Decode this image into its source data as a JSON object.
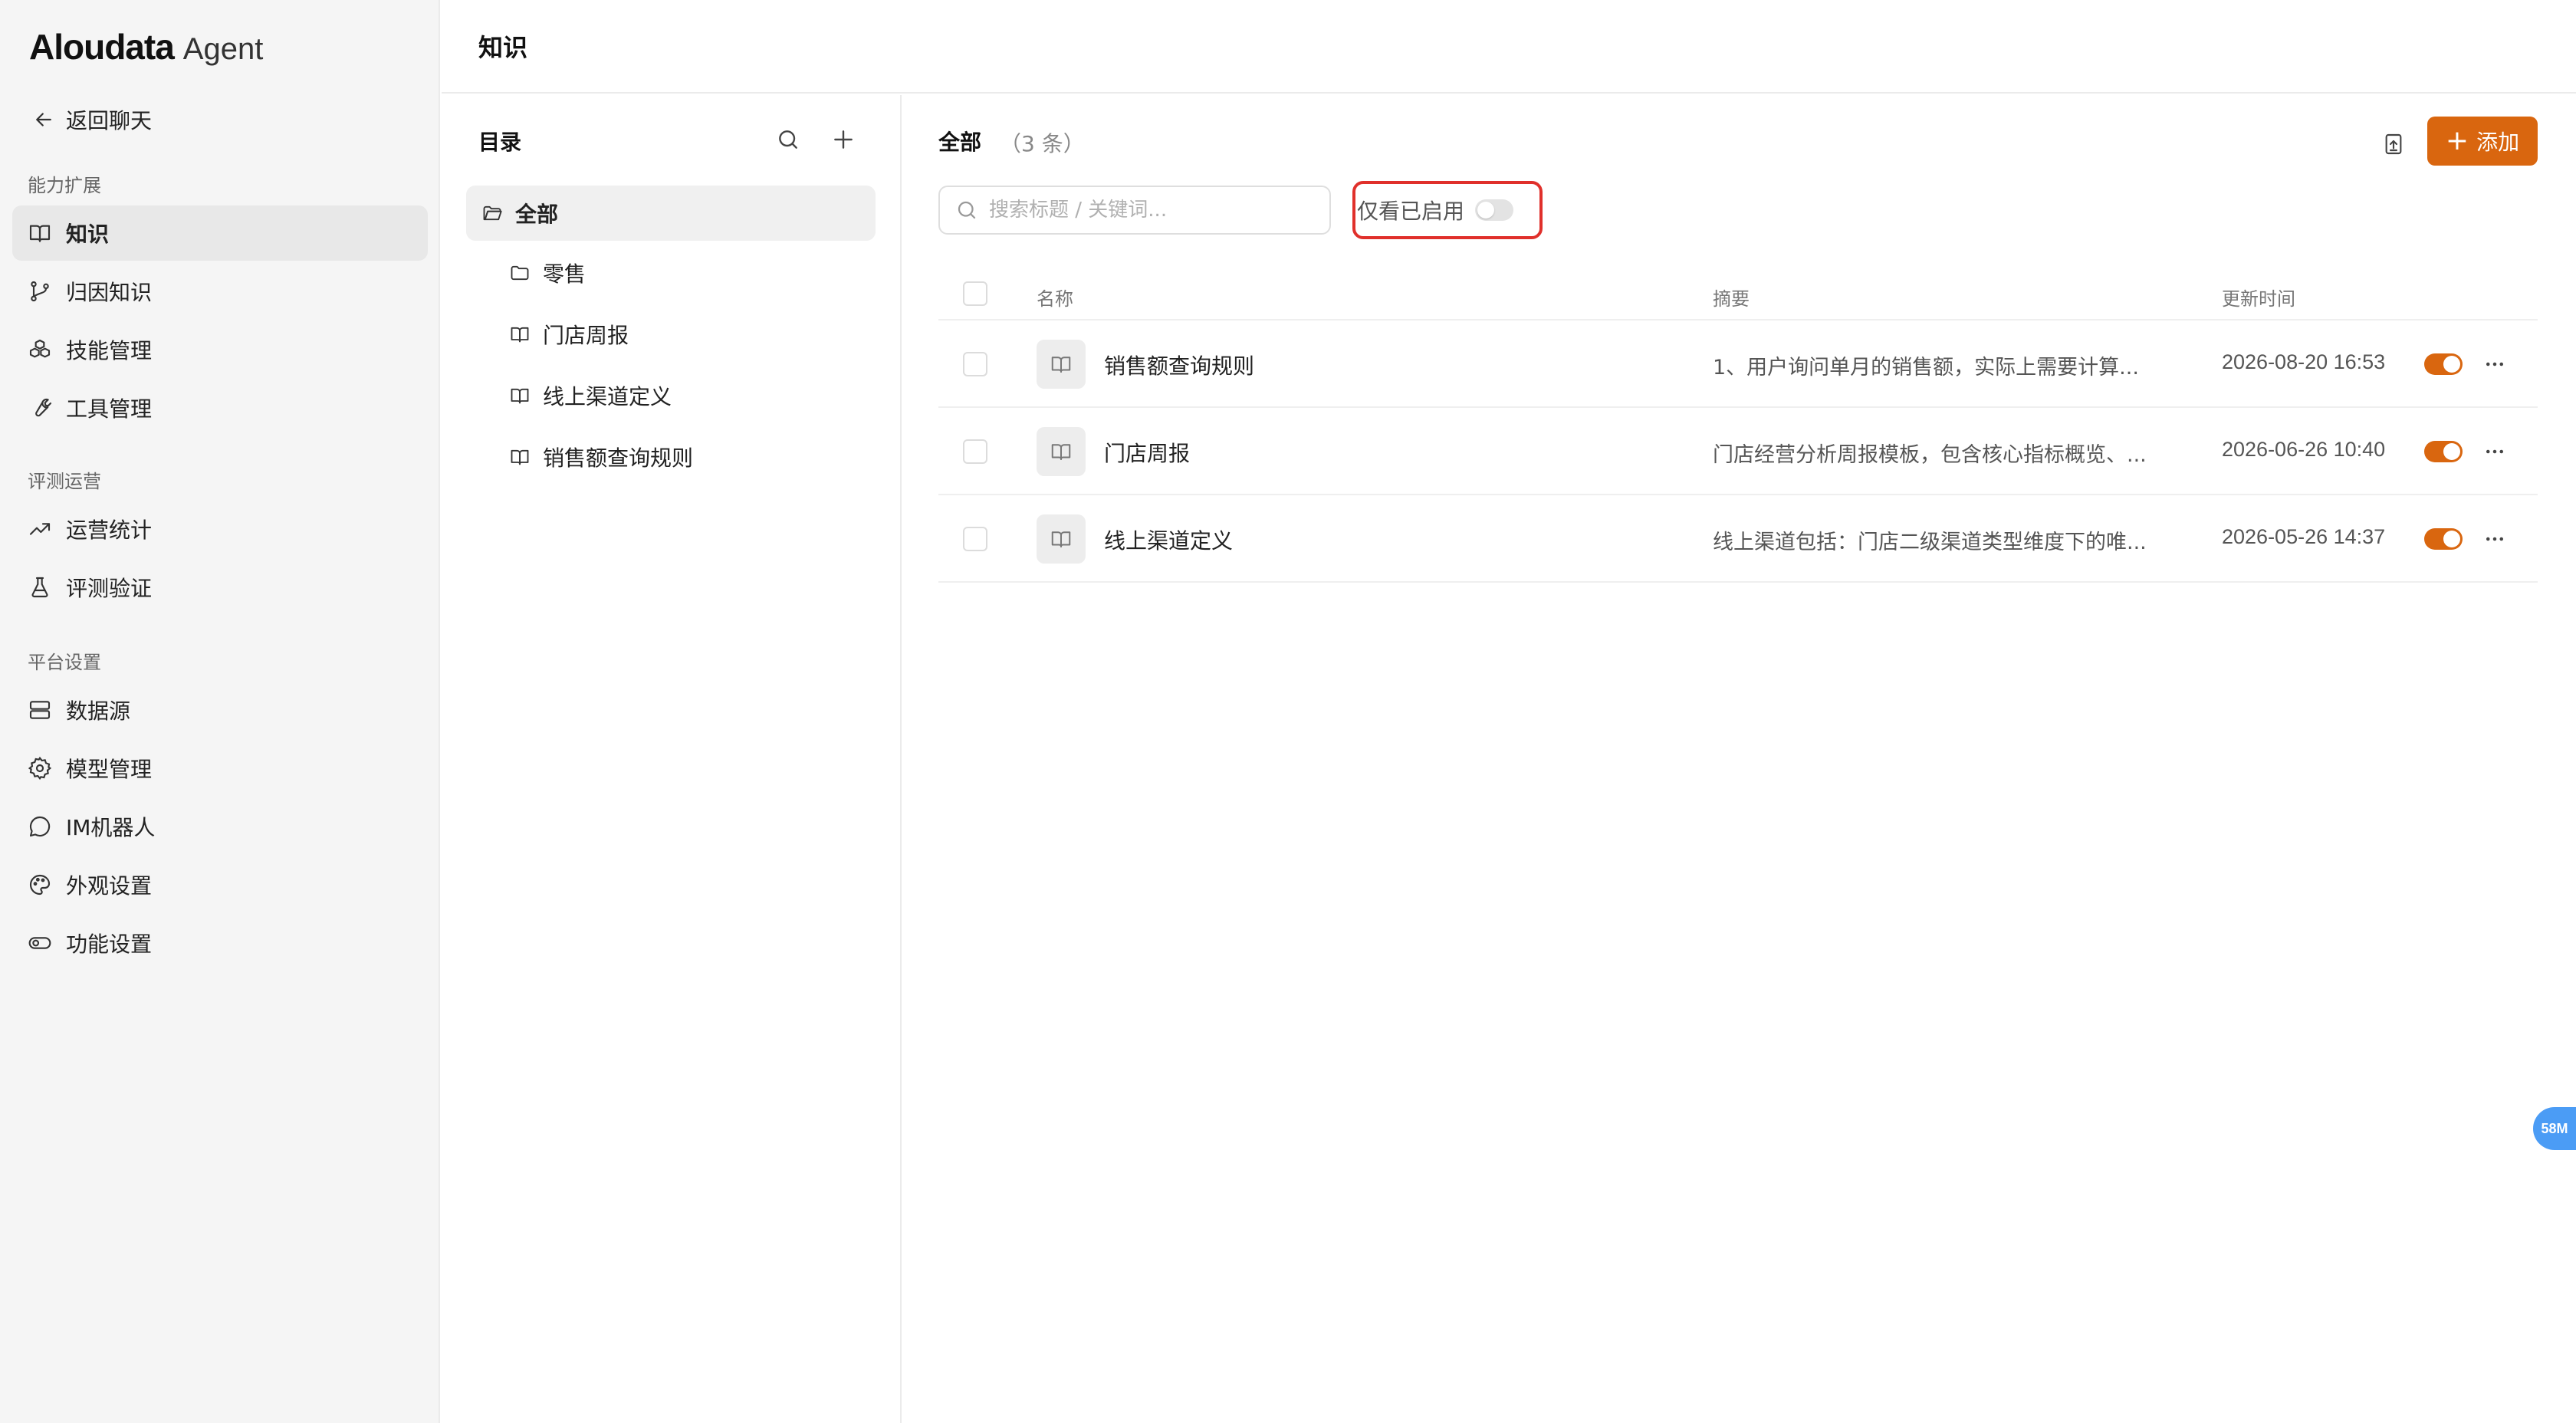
{
  "brand": {
    "main": "Aloudata",
    "sub": "Agent"
  },
  "sidebar": {
    "back_label": "返回聊天",
    "groups": [
      {
        "label": "能力扩展",
        "items": [
          {
            "label": "知识",
            "icon": "book-icon",
            "active": true
          },
          {
            "label": "归因知识",
            "icon": "branch-icon"
          },
          {
            "label": "技能管理",
            "icon": "cubes-icon"
          },
          {
            "label": "工具管理",
            "icon": "wrench-icon"
          }
        ]
      },
      {
        "label": "评测运营",
        "items": [
          {
            "label": "运营统计",
            "icon": "trend-icon"
          },
          {
            "label": "评测验证",
            "icon": "flask-icon"
          }
        ]
      },
      {
        "label": "平台设置",
        "items": [
          {
            "label": "数据源",
            "icon": "server-icon"
          },
          {
            "label": "模型管理",
            "icon": "gear-icon"
          },
          {
            "label": "IM机器人",
            "icon": "chat-icon"
          },
          {
            "label": "外观设置",
            "icon": "palette-icon"
          },
          {
            "label": "功能设置",
            "icon": "toggle-icon"
          }
        ]
      }
    ]
  },
  "header": {
    "title": "知识"
  },
  "catalog": {
    "title": "目录",
    "root": {
      "label": "全部",
      "icon": "folder-open-icon"
    },
    "children": [
      {
        "label": "零售",
        "icon": "folder-icon"
      },
      {
        "label": "门店周报",
        "icon": "book-icon"
      },
      {
        "label": "线上渠道定义",
        "icon": "book-icon"
      },
      {
        "label": "销售额查询规则",
        "icon": "book-icon"
      }
    ]
  },
  "main": {
    "title": "全部",
    "count": "（3 条）",
    "add_label": "添加",
    "search_placeholder": "搜索标题 / 关键词...",
    "filter_label": "仅看已启用",
    "filter_enabled": false,
    "columns": {
      "name": "名称",
      "summary": "摘要",
      "updated": "更新时间"
    },
    "rows": [
      {
        "name": "销售额查询规则",
        "summary": "1、用户询问单月的销售额，实际上需要计算...",
        "updated": "2026-08-20 16:53",
        "enabled": true
      },
      {
        "name": "门店周报",
        "summary": "门店经营分析周报模板，包含核心指标概览、...",
        "updated": "2026-06-26 10:40",
        "enabled": true
      },
      {
        "name": "线上渠道定义",
        "summary": "线上渠道包括：门店二级渠道类型维度下的唯...",
        "updated": "2026-05-26 14:37",
        "enabled": true
      }
    ]
  },
  "memory_badge": "58M",
  "colors": {
    "accent": "#d9660f",
    "highlight_border": "#e0302b",
    "badge": "#4b9cf5"
  }
}
